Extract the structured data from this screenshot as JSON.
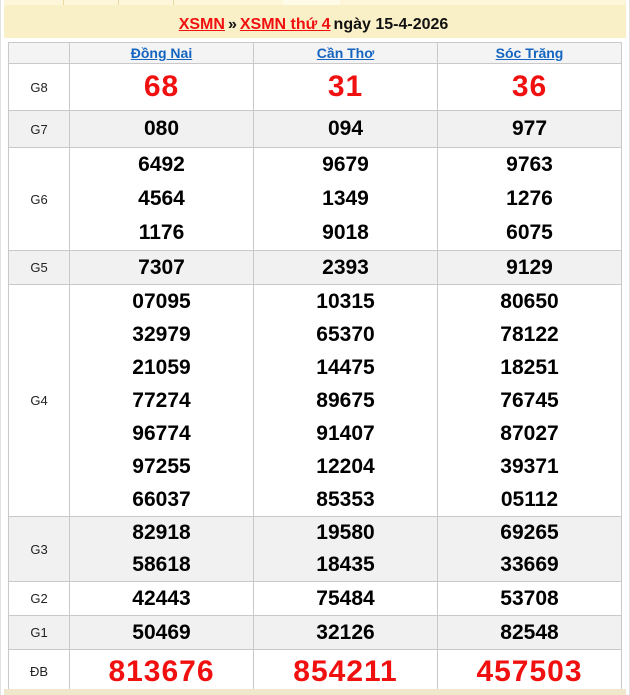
{
  "banner": {
    "title": {
      "link1": "XSMN",
      "separator": "»",
      "link2": "XSMN thứ 4",
      "date": "ngày 15-4-2026"
    }
  },
  "table": {
    "columns": [
      "Đồng Nai",
      "Cần Thơ",
      "Sóc Trăng"
    ],
    "rows": [
      {
        "label": "G8",
        "highlight": true,
        "cells": [
          [
            "68"
          ],
          [
            "31"
          ],
          [
            "36"
          ]
        ]
      },
      {
        "label": "G7",
        "highlight": false,
        "cells": [
          [
            "080"
          ],
          [
            "094"
          ],
          [
            "977"
          ]
        ]
      },
      {
        "label": "G6",
        "highlight": false,
        "cells": [
          [
            "6492",
            "4564",
            "1176"
          ],
          [
            "9679",
            "1349",
            "9018"
          ],
          [
            "9763",
            "1276",
            "6075"
          ]
        ]
      },
      {
        "label": "G5",
        "highlight": false,
        "cells": [
          [
            "7307"
          ],
          [
            "2393"
          ],
          [
            "9129"
          ]
        ]
      },
      {
        "label": "G4",
        "highlight": false,
        "cells": [
          [
            "07095",
            "32979",
            "21059",
            "77274",
            "96774",
            "97255",
            "66037"
          ],
          [
            "10315",
            "65370",
            "14475",
            "89675",
            "91407",
            "12204",
            "85353"
          ],
          [
            "80650",
            "78122",
            "18251",
            "76745",
            "87027",
            "39371",
            "05112"
          ]
        ]
      },
      {
        "label": "G3",
        "highlight": false,
        "cells": [
          [
            "82918",
            "58618"
          ],
          [
            "19580",
            "18435"
          ],
          [
            "69265",
            "33669"
          ]
        ]
      },
      {
        "label": "G2",
        "highlight": false,
        "cells": [
          [
            "42443"
          ],
          [
            "75484"
          ],
          [
            "53708"
          ]
        ]
      },
      {
        "label": "G1",
        "highlight": false,
        "cells": [
          [
            "50469"
          ],
          [
            "32126"
          ],
          [
            "82548"
          ]
        ]
      },
      {
        "label": "ĐB",
        "highlight": true,
        "cells": [
          [
            "813676"
          ],
          [
            "854211"
          ],
          [
            "457503"
          ]
        ]
      }
    ]
  },
  "colors": {
    "accent_red": "#f01010",
    "link_blue": "#1565c0",
    "banner_yellow": "#faf0c8",
    "row_shade": "#f1f1f1",
    "table_border": "#c9c9c9"
  }
}
